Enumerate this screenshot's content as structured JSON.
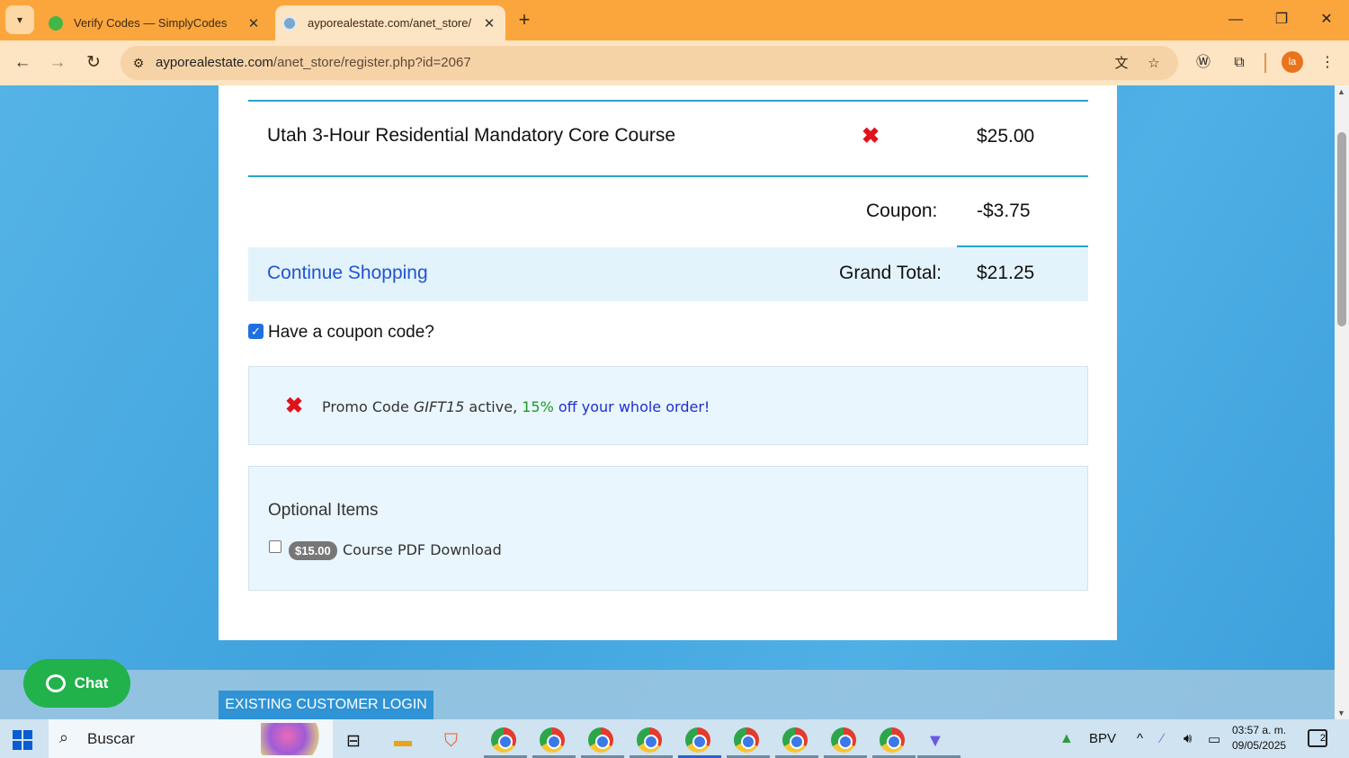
{
  "browser": {
    "tabs": [
      {
        "title": "Verify Codes — SimplyCodes",
        "active": false
      },
      {
        "title": "ayporealestate.com/anet_store/",
        "active": true
      }
    ],
    "url_domain": "ayporealestate.com",
    "url_path": "/anet_store/register.php?id=2067",
    "profile_initials": "la"
  },
  "cart": {
    "item_name": "Utah 3-Hour Residential Mandatory Core Course",
    "item_price": "$25.00",
    "coupon_label": "Coupon:",
    "coupon_value": "-$3.75",
    "continue_label": "Continue Shopping",
    "grand_total_label": "Grand Total:",
    "grand_total_value": "$21.25"
  },
  "coupon": {
    "question": "Have a coupon code?",
    "checked": true,
    "promo_prefix": "Promo Code ",
    "promo_code": "GIFT15",
    "promo_active": " active, ",
    "promo_percent": "15%",
    "promo_rest": " off your whole order!"
  },
  "optional": {
    "title": "Optional Items",
    "items": [
      {
        "price": "$15.00",
        "label": "Course PDF Download",
        "checked": false
      }
    ]
  },
  "page": {
    "login_button": "EXISTING CUSTOMER LOGIN",
    "chat_label": "Chat"
  },
  "taskbar": {
    "search_placeholder": "Buscar",
    "tray_label": "BPV",
    "time": "03:57 a. m.",
    "date": "09/05/2025",
    "notification_count": "2"
  },
  "colors": {
    "tabbar": "#fba63c",
    "page_bg": "#4aa9e0",
    "accent_line": "#29a3cf",
    "remove_red": "#e0121a",
    "link_blue": "#1f54d4",
    "promo_green": "#1f9a2a",
    "chat_green": "#21b24b"
  }
}
